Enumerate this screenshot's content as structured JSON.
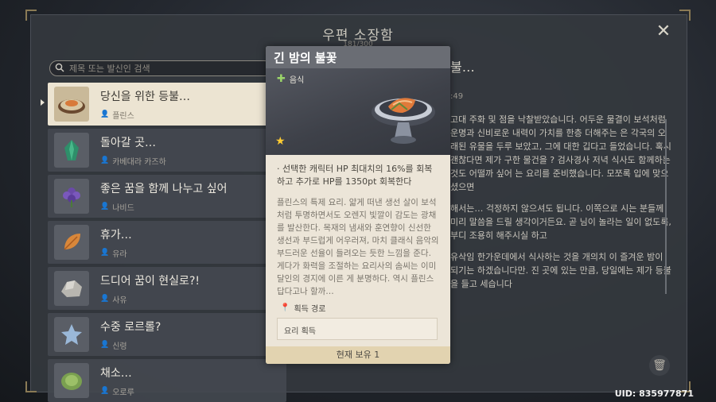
{
  "window": {
    "title": "우편 소장함",
    "subtitle": "181/300",
    "close_icon": "close-icon",
    "uid": "UID: 835977871"
  },
  "search": {
    "placeholder": "제목 또는 발신인 검색",
    "value": ""
  },
  "mails": [
    {
      "title": "당신을 위한 등불…",
      "sender": "플린스",
      "icon": "food-icon",
      "selected": true
    },
    {
      "title": "돌아갈 곳…",
      "sender": "카베대라 카즈하",
      "icon": "crystal-icon",
      "selected": false
    },
    {
      "title": "좋은 꿈을 함께 나누고 싶어",
      "sender": "나비드",
      "icon": "flower-icon",
      "selected": false
    },
    {
      "title": "휴가…",
      "sender": "유라",
      "icon": "leaf-icon",
      "selected": false
    },
    {
      "title": "드디어 꿈이 현실로?!",
      "sender": "사유",
      "icon": "ore-icon",
      "selected": false
    },
    {
      "title": "수중 로르롤?",
      "sender": "신령",
      "icon": "star-icon",
      "selected": false
    },
    {
      "title": "채소…",
      "sender": "오로루",
      "icon": "cabbage-icon",
      "selected": false
    }
  ],
  "mail_content": {
    "title": "불…",
    "time": ":49",
    "paragraphs": [
      "고대 주화 및 점을 낙찰받았습니다. 어두운 물결이 보석처럼 운명과 신비로운 내력이 가치를 한층 더해주는 은 각국의 오래된 유물을 두루 보았고, 그에 대한 깁다고 들었습니다. 혹시 괜찮다면 제가 구한 물건을 ? 검사경사 저녁 식사도 함께하는 것도 어떨까 싶어 는 요리를 준비했습니다. 모쪼록 입에 맞으셨으면",
      "해서는… 걱정하지 않으셔도 됩니다. 이쪽으로 시는 분들께 미리 말씀을 드릴 생각이거든요. 곧 님이 놀라는 일이 없도록, 부디 조용히 해주시실 하고",
      "유삭임 한가운데에서 식사하는 것을 개의치 이 즐겨운 밤이 되기는 하겠습니다만. 진 곳에 있는 만큼, 당일에는 제가 등불을 들고 세습니다"
    ]
  },
  "item_card": {
    "name": "긴 밤의 불꽃",
    "type": "음식",
    "rarity": 1,
    "effect": "· 선택한 캐릭터 HP 최대치의 16%를 회복하고 추가로 HP를 1350pt 회복한다",
    "description": "플린스의 특제 요리. 얇게 떠낸 생선 살이 보석처럼 투명하면서도 오렌지 빛깔이 감도는 광채를 발산한다. 목재의 냄새와 훈연향이 신선한 생선과 부드럽게 어우러져, 마치 클래식 음악의 부드러운 선율이 들려오는 듯한 느낌을 준다. 게다가 화력을 조절하는 요리사의 솜씨는 이미 달인의 경지에 이른 게 분명하다. 역시 플린스답다고나 할까…",
    "acquire_label": "획득 경로",
    "acquire_value": "요리 획득",
    "owned": "현재 보유 1"
  },
  "colors": {
    "card_bg": "#ece5d8",
    "selected_mail": "#ece4d2",
    "star": "#ffcc32",
    "food_icon": "#9bd46a"
  }
}
